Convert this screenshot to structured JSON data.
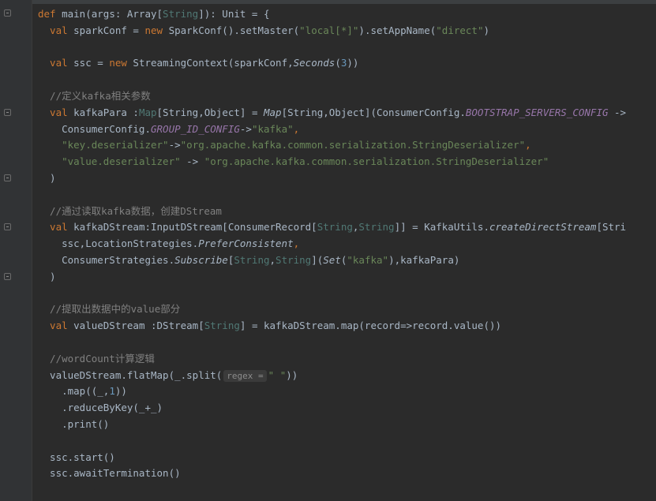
{
  "colors": {
    "background": "#2b2b2b",
    "keyword": "#cc7832",
    "string": "#6a8759",
    "number": "#6897bb",
    "comment": "#808080",
    "text": "#a9b7c6",
    "static_field": "#9876aa"
  },
  "code": {
    "l1": {
      "a": "def ",
      "b": "main(args: Array[",
      "c": "String",
      "d": "]): Unit = {"
    },
    "l2": {
      "a": "  val ",
      "b": "sparkConf = ",
      "c": "new ",
      "d": "SparkConf().setMaster(",
      "e": "\"local[*]\"",
      "f": ").setAppName(",
      "g": "\"direct\"",
      "h": ")"
    },
    "l4": {
      "a": "  val ",
      "b": "ssc = ",
      "c": "new ",
      "d": "StreamingContext(sparkConf,",
      "e": "Seconds",
      "f": "(",
      "g": "3",
      "h": "))"
    },
    "l6": {
      "a": "  //定义kafka相关参数"
    },
    "l7": {
      "a": "  val ",
      "b": "kafkaPara :",
      "c": "Map",
      "d": "[String,Object] = ",
      "e": "Map",
      "f": "[String,Object](ConsumerConfig.",
      "g": "BOOTSTRAP_SERVERS_CONFIG",
      "h": " ->"
    },
    "l8": {
      "a": "    ConsumerConfig.",
      "b": "GROUP_ID_CONFIG",
      "c": "->",
      "d": "\"kafka\"",
      "e": ","
    },
    "l9": {
      "a": "    ",
      "b": "\"key.deserializer\"",
      "c": "->",
      "d": "\"org.apache.kafka.common.serialization.StringDeserializer\"",
      "e": ","
    },
    "l10": {
      "a": "    ",
      "b": "\"value.deserializer\"",
      "c": " -> ",
      "d": "\"org.apache.kafka.common.serialization.StringDeserializer\""
    },
    "l11": {
      "a": "  )"
    },
    "l13": {
      "a": "  //通过读取kafka数据，创建DStream"
    },
    "l14": {
      "a": "  val ",
      "b": "kafkaDStream:InputDStream[ConsumerRecord[",
      "c": "String",
      "d": ",",
      "e": "String",
      "f": "]] = KafkaUtils.",
      "g": "createDirectStream",
      "h": "[Stri"
    },
    "l15": {
      "a": "    ssc,LocationStrategies.",
      "b": "PreferConsistent",
      "c": ","
    },
    "l16": {
      "a": "    ConsumerStrategies.",
      "b": "Subscribe",
      "c": "[",
      "d": "String",
      "e": ",",
      "f": "String",
      "g": "](",
      "h": "Set",
      "i": "(",
      "j": "\"kafka\"",
      "k": "),kafkaPara)"
    },
    "l17": {
      "a": "  )"
    },
    "l19": {
      "a": "  //提取出数据中的value部分"
    },
    "l20": {
      "a": "  val ",
      "b": "valueDStream :DStream[",
      "c": "String",
      "d": "] = kafkaDStream.map(record=>record.value())"
    },
    "l22": {
      "a": "  //wordCount计算逻辑"
    },
    "l23": {
      "a": "  valueDStream.flatMap(_.split(",
      "hint": "regex =",
      "b": "\" \"",
      "c": "))"
    },
    "l24": {
      "a": "    .map((_,",
      "b": "1",
      "c": "))"
    },
    "l25": {
      "a": "    .reduceByKey(_+_)"
    },
    "l26": {
      "a": "    .print()"
    },
    "l28": {
      "a": "  ssc.start()"
    },
    "l29": {
      "a": "  ssc.awaitTermination()"
    }
  }
}
